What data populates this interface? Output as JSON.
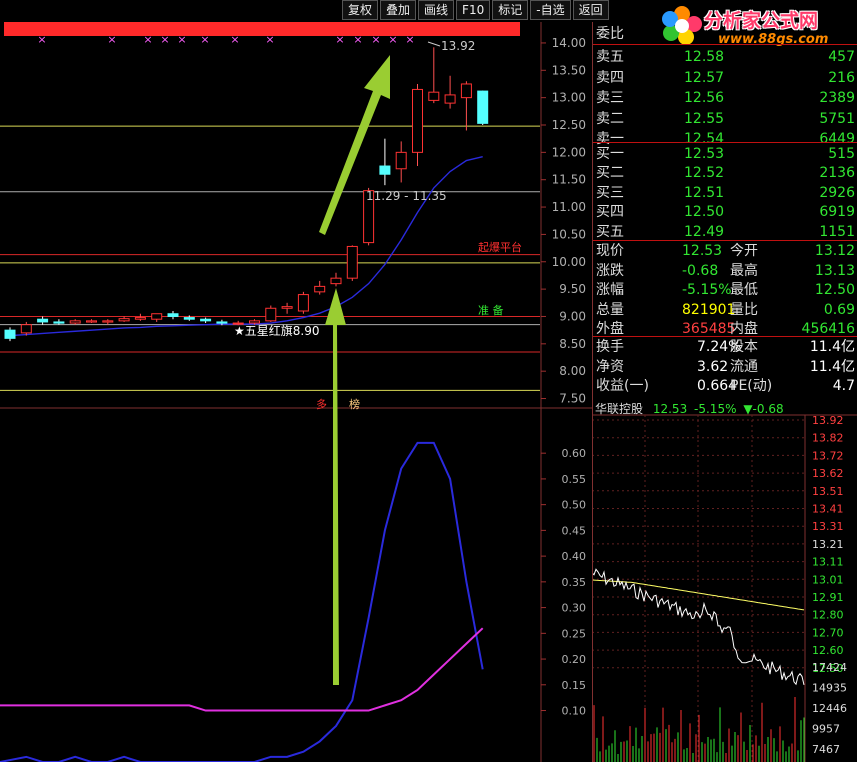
{
  "toolbar": {
    "buttons": [
      "复权",
      "叠加",
      "画线",
      "F10",
      "标记",
      "-自选",
      "返回"
    ]
  },
  "watermark": {
    "title": "分析家公式网",
    "url": "www.88gs.com"
  },
  "orderbook": {
    "header": "委比",
    "sells": [
      {
        "label": "卖五",
        "price": "12.58",
        "vol": "457"
      },
      {
        "label": "卖四",
        "price": "12.57",
        "vol": "216"
      },
      {
        "label": "卖三",
        "price": "12.56",
        "vol": "2389"
      },
      {
        "label": "卖二",
        "price": "12.55",
        "vol": "5751"
      },
      {
        "label": "卖一",
        "price": "12.54",
        "vol": "6449"
      }
    ],
    "buys": [
      {
        "label": "买一",
        "price": "12.53",
        "vol": "515"
      },
      {
        "label": "买二",
        "price": "12.52",
        "vol": "2136"
      },
      {
        "label": "买三",
        "price": "12.51",
        "vol": "2926"
      },
      {
        "label": "买四",
        "price": "12.50",
        "vol": "6919"
      },
      {
        "label": "买五",
        "price": "12.49",
        "vol": "1151"
      }
    ],
    "stats": [
      {
        "l1": "现价",
        "v1": "12.53",
        "l2": "今开",
        "v2": "13.12"
      },
      {
        "l1": "涨跌",
        "v1": "-0.68",
        "l2": "最高",
        "v2": "13.13"
      },
      {
        "l1": "涨幅",
        "v1": "-5.15%",
        "l2": "最低",
        "v2": "12.50"
      },
      {
        "l1": "总量",
        "v1": "821901",
        "l2": "量比",
        "v2": "0.69"
      },
      {
        "l1": "外盘",
        "v1": "365485",
        "l2": "内盘",
        "v2": "456416"
      }
    ],
    "stats2": [
      {
        "l1": "换手",
        "v1": "7.24%",
        "l2": "股本",
        "v2": "11.4亿"
      },
      {
        "l1": "净资",
        "v1": "3.62",
        "l2": "流通",
        "v2": "11.4亿"
      },
      {
        "l1": "收益(一)",
        "v1": "0.664",
        "l2": "PE(动)",
        "v2": "4.7"
      }
    ]
  },
  "mini_chart": {
    "name": "华联控股",
    "price": "12.53",
    "change_pct": "-5.15%",
    "change": "▼-0.68",
    "price_axis": [
      "13.92",
      "13.82",
      "13.72",
      "13.62",
      "13.51",
      "13.41",
      "13.31",
      "13.21",
      "13.11",
      "13.01",
      "12.91",
      "12.80",
      "12.70",
      "12.60",
      "12.50"
    ],
    "vol_axis": [
      "17424",
      "14935",
      "12446",
      "9957",
      "7467"
    ]
  },
  "annotations": {
    "high_label": "13.92",
    "range_label": "11.29 - 11.35",
    "star_label": "★五星红旗8.90",
    "breakout_label": "起爆平台",
    "ready_label": "准 备",
    "bottom_mark1": "多",
    "bottom_mark2": "榜"
  },
  "chart_data": [
    {
      "type": "candlestick",
      "title": "",
      "ylim": [
        7.4,
        14.2
      ],
      "y_ticks": [
        "14.00",
        "13.50",
        "13.00",
        "12.50",
        "12.00",
        "11.50",
        "11.00",
        "10.50",
        "10.00",
        "9.50",
        "9.00",
        "8.50",
        "8.00",
        "7.50"
      ],
      "candles": [
        {
          "o": 8.75,
          "h": 8.8,
          "l": 8.55,
          "c": 8.6
        },
        {
          "o": 8.7,
          "h": 8.9,
          "l": 8.65,
          "c": 8.85
        },
        {
          "o": 8.95,
          "h": 9.0,
          "l": 8.85,
          "c": 8.9
        },
        {
          "o": 8.9,
          "h": 8.95,
          "l": 8.85,
          "c": 8.88
        },
        {
          "o": 8.88,
          "h": 8.95,
          "l": 8.85,
          "c": 8.92
        },
        {
          "o": 8.9,
          "h": 8.95,
          "l": 8.88,
          "c": 8.92
        },
        {
          "o": 8.9,
          "h": 8.95,
          "l": 8.85,
          "c": 8.92
        },
        {
          "o": 8.92,
          "h": 9.0,
          "l": 8.9,
          "c": 8.96
        },
        {
          "o": 8.95,
          "h": 9.05,
          "l": 8.92,
          "c": 8.98
        },
        {
          "o": 8.95,
          "h": 9.05,
          "l": 8.9,
          "c": 9.05
        },
        {
          "o": 9.05,
          "h": 9.1,
          "l": 8.95,
          "c": 9.0
        },
        {
          "o": 8.98,
          "h": 9.02,
          "l": 8.92,
          "c": 8.95
        },
        {
          "o": 8.95,
          "h": 8.98,
          "l": 8.88,
          "c": 8.92
        },
        {
          "o": 8.9,
          "h": 8.94,
          "l": 8.84,
          "c": 8.88
        },
        {
          "o": 8.88,
          "h": 8.92,
          "l": 8.84,
          "c": 8.88
        },
        {
          "o": 8.88,
          "h": 8.95,
          "l": 8.85,
          "c": 8.92
        },
        {
          "o": 8.92,
          "h": 9.2,
          "l": 8.9,
          "c": 9.15
        },
        {
          "o": 9.15,
          "h": 9.25,
          "l": 9.05,
          "c": 9.18
        },
        {
          "o": 9.1,
          "h": 9.45,
          "l": 9.05,
          "c": 9.4
        },
        {
          "o": 9.45,
          "h": 9.65,
          "l": 9.4,
          "c": 9.55
        },
        {
          "o": 9.6,
          "h": 9.8,
          "l": 9.55,
          "c": 9.7
        },
        {
          "o": 9.7,
          "h": 10.3,
          "l": 9.65,
          "c": 10.28
        },
        {
          "o": 10.35,
          "h": 11.35,
          "l": 10.3,
          "c": 11.3
        },
        {
          "o": 11.75,
          "h": 12.25,
          "l": 11.4,
          "c": 11.6
        },
        {
          "o": 11.7,
          "h": 12.2,
          "l": 11.45,
          "c": 12.0
        },
        {
          "o": 12.0,
          "h": 13.25,
          "l": 11.75,
          "c": 13.15
        },
        {
          "o": 12.95,
          "h": 13.92,
          "l": 12.9,
          "c": 13.1
        },
        {
          "o": 12.9,
          "h": 13.4,
          "l": 12.8,
          "c": 13.05
        },
        {
          "o": 13.0,
          "h": 13.3,
          "l": 12.4,
          "c": 13.25
        },
        {
          "o": 13.12,
          "h": 13.13,
          "l": 12.5,
          "c": 12.53
        }
      ],
      "ma": [
        8.65,
        8.67,
        8.69,
        8.71,
        8.73,
        8.75,
        8.77,
        8.79,
        8.8,
        8.82,
        8.83,
        8.84,
        8.85,
        8.86,
        8.86,
        8.86,
        8.88,
        8.92,
        8.98,
        9.06,
        9.18,
        9.35,
        9.6,
        9.95,
        10.4,
        10.9,
        11.35,
        11.65,
        11.85,
        11.92
      ],
      "hlines": [
        {
          "y": 12.48,
          "color": "#ffff66"
        },
        {
          "y": 11.28,
          "color": "#cccccc"
        },
        {
          "y": 10.13,
          "color": "#ff3030"
        },
        {
          "y": 9.98,
          "color": "#ffff66"
        },
        {
          "y": 9.0,
          "color": "#ff3030"
        },
        {
          "y": 8.85,
          "color": "#cccccc"
        },
        {
          "y": 8.35,
          "color": "#ff3030"
        },
        {
          "y": 7.65,
          "color": "#ffff66"
        }
      ]
    },
    {
      "type": "line",
      "title": "",
      "ylim": [
        0.0,
        0.68
      ],
      "y_ticks": [
        "0.60",
        "0.55",
        "0.50",
        "0.45",
        "0.40",
        "0.35",
        "0.30",
        "0.25",
        "0.20",
        "0.15",
        "0.10"
      ],
      "series": [
        {
          "color": "#2a2adc",
          "values": [
            0.0,
            0.01,
            0.0,
            0.0,
            0.01,
            0.0,
            0.0,
            0.01,
            0.0,
            0.0,
            0.0,
            0.0,
            0.0,
            0.0,
            0.0,
            0.0,
            0.01,
            0.01,
            0.02,
            0.04,
            0.07,
            0.12,
            0.28,
            0.45,
            0.57,
            0.62,
            0.62,
            0.55,
            0.35,
            0.18
          ]
        },
        {
          "color": "#e030e0",
          "values": [
            0.11,
            0.11,
            0.11,
            0.11,
            0.11,
            0.11,
            0.11,
            0.11,
            0.11,
            0.11,
            0.11,
            0.11,
            0.1,
            0.1,
            0.1,
            0.1,
            0.1,
            0.1,
            0.1,
            0.1,
            0.1,
            0.1,
            0.1,
            0.11,
            0.12,
            0.14,
            0.17,
            0.2,
            0.23,
            0.26
          ]
        }
      ]
    }
  ]
}
